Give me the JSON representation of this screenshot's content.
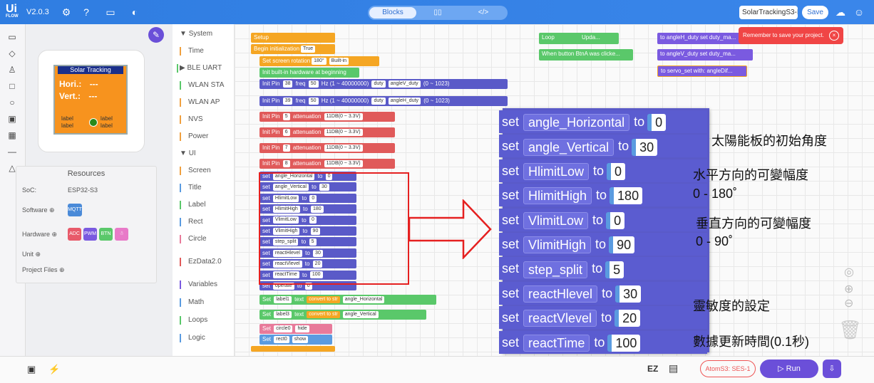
{
  "app": {
    "logo": "Ui",
    "logo_sub": "FLOW",
    "version": "V2.0.3"
  },
  "header": {
    "tabs": [
      "Blocks",
      "",
      ""
    ],
    "project_name": "SolarTrackingS3-I",
    "save_label": "Save"
  },
  "device": {
    "title": "Solar Tracking",
    "hori": "Hori.:",
    "vert": "Vert.:",
    "hori_val": "---",
    "vert_val": "---",
    "label": "label"
  },
  "resources": {
    "title": "Resources",
    "soc_label": "SoC:",
    "soc_value": "ESP32-S3",
    "software": "Software",
    "hardware": "Hardware",
    "unit": "Unit",
    "project_files": "Project Files",
    "chips": [
      "MQTT",
      "ADC",
      "PWM",
      "BTN",
      "☃"
    ]
  },
  "categories": [
    "System",
    "Time",
    "BLE UART",
    "WLAN STA",
    "WLAN AP",
    "NVS",
    "Power",
    "UI",
    "Screen",
    "Title",
    "Label",
    "Rect",
    "Circle",
    "EzData2.0",
    "Variables",
    "Math",
    "Loops",
    "Logic"
  ],
  "blocks": {
    "setup": "Setup",
    "begin": "Begin initialization",
    "begin_toggle": "True",
    "rotation": "Set screen rotation",
    "rotation_val": "180°",
    "builtin": "Built-in",
    "init_hw": "Init built-in hardware at beginning",
    "pins": [
      [
        "38",
        "50",
        "angleV_duty"
      ],
      [
        "39",
        "50",
        "angleH_duty"
      ]
    ],
    "pin_freq_range": "Hz (1 ~ 40000000)",
    "pin_duty": "duty",
    "pin_duty_range": "(0 ~ 1023)",
    "adc": [
      "5",
      "6",
      "7",
      "8"
    ],
    "adc_att": "11DB(0 ~ 3.3V)",
    "vars": [
      [
        "angle_Horizontal",
        "0"
      ],
      [
        "angle_Vertical",
        "30"
      ],
      [
        "HlimitLow",
        "0"
      ],
      [
        "HlimitHigh",
        "180"
      ],
      [
        "VlimitLow",
        "0"
      ],
      [
        "VlimitHigh",
        "90"
      ],
      [
        "step_split",
        "5"
      ],
      [
        "reactHlevel",
        "30"
      ],
      [
        "reactVlevel",
        "20"
      ],
      [
        "reactTime",
        "100"
      ],
      [
        "operate",
        "0"
      ]
    ],
    "label1": "label1",
    "label3": "label3",
    "text": "text",
    "convert": "convert to str",
    "circle0": "circle0",
    "hide": "hide",
    "rect0": "rect0",
    "show": "show",
    "loop": "Loop",
    "upda": "Upda...",
    "btn": "When button BtnA was clicke...",
    "r1": "to angleH_duty  set duty_ma...",
    "r2": "to angleV_duty  set duty_ma...",
    "r3": "to servo_set with: angleDif..."
  },
  "toast": "Remember to save your project.",
  "zoom": {
    "set": "set",
    "to": "to",
    "rows": [
      [
        "angle_Horizontal",
        "0"
      ],
      [
        "angle_Vertical",
        "30"
      ],
      [
        "HlimitLow",
        "0"
      ],
      [
        "HlimitHigh",
        "180"
      ],
      [
        "VlimitLow",
        "0"
      ],
      [
        "VlimitHigh",
        "90"
      ],
      [
        "step_split",
        "5"
      ],
      [
        "reactHlevel",
        "30"
      ],
      [
        "reactVlevel",
        "20"
      ],
      [
        "reactTime",
        "100"
      ]
    ]
  },
  "annotations": [
    "太陽能板的初始角度",
    "水平方向的可變幅度",
    "0 - 180˚",
    "垂直方向的可變幅度",
    "0 - 90˚",
    "靈敏度的設定",
    "數據更新時間(0.1秒)"
  ],
  "bottom": {
    "atom": "AtomS3: SES-1",
    "run": "Run"
  }
}
